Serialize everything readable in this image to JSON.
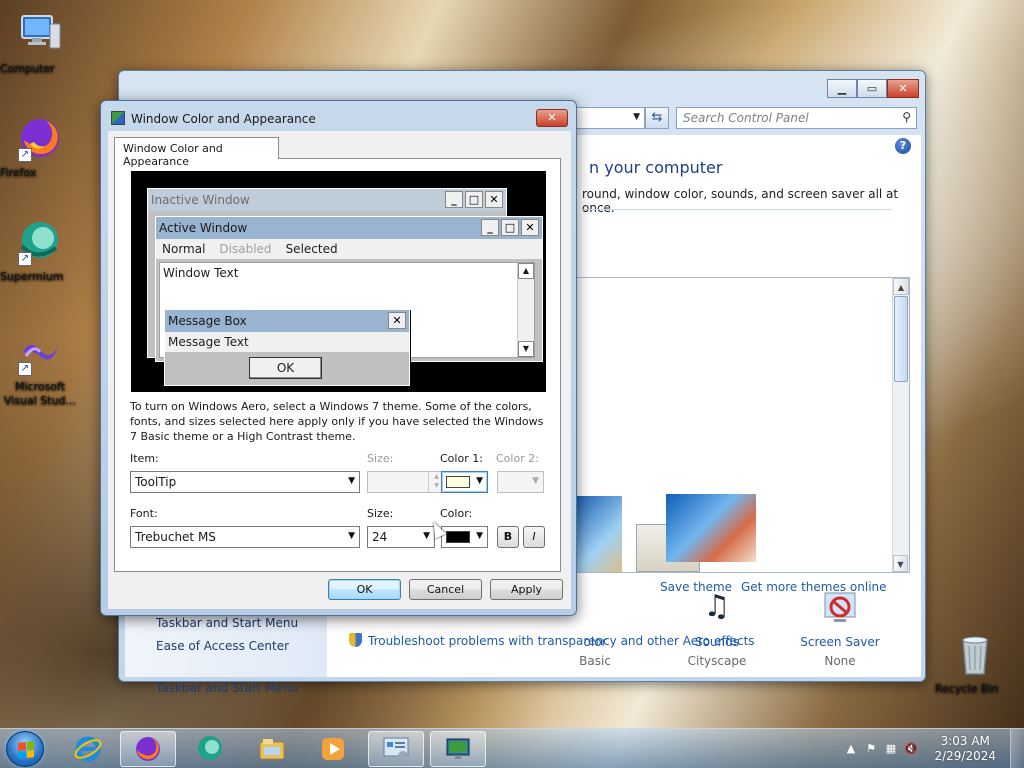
{
  "desktop": {
    "icons": [
      {
        "label": "Computer",
        "icon": "computer-icon"
      },
      {
        "label": "Firefox",
        "icon": "firefox-icon"
      },
      {
        "label": "Supermium",
        "icon": "supermium-icon"
      },
      {
        "label": "Microsoft Visual Stud...",
        "icon": "visual-studio-icon"
      },
      {
        "label": "Recycle Bin",
        "icon": "recycle-bin-icon"
      }
    ]
  },
  "control_panel": {
    "search_placeholder": "Search Control Panel",
    "heading": "n your computer",
    "subheading": "round, window color, sounds, and screen saver all at once.",
    "left_links": [
      "Taskbar and Start Menu",
      "Ease of Access Center"
    ],
    "save_theme": "Save theme",
    "get_more_themes": "Get more themes online",
    "bottom_items": [
      {
        "title": "olor",
        "subtitle": "Basic",
        "icon": "color-icon"
      },
      {
        "title": "Sounds",
        "subtitle": "Cityscape",
        "icon": "sounds-icon"
      },
      {
        "title": "Screen Saver",
        "subtitle": "None",
        "icon": "screen-saver-icon"
      }
    ],
    "troubleshoot": "Troubleshoot problems with transparency and other Aero effects"
  },
  "dialog": {
    "title": "Window Color and Appearance",
    "tab_label": "Window Color and Appearance",
    "preview": {
      "inactive_title": "Inactive Window",
      "active_title": "Active Window",
      "menu_normal": "Normal",
      "menu_disabled": "Disabled",
      "menu_selected": "Selected",
      "window_text": "Window Text",
      "message_box_title": "Message Box",
      "message_text": "Message Text",
      "ok_label": "OK"
    },
    "description": "To turn on Windows Aero, select a Windows 7 theme.  Some of the colors, fonts, and sizes selected here apply only if you have selected the Windows 7 Basic theme or a High Contrast theme.",
    "item_label": "Item:",
    "item_value": "ToolTip",
    "item_size_label": "Size:",
    "color1_label": "Color 1:",
    "color2_label": "Color 2:",
    "color1_value": "#ffffe1",
    "font_label": "Font:",
    "font_value": "Trebuchet MS",
    "font_size_label": "Size:",
    "font_size_value": "24",
    "font_color_label": "Color:",
    "font_color_value": "#000000",
    "bold_label": "B",
    "italic_label": "I",
    "ok": "OK",
    "cancel": "Cancel",
    "apply": "Apply"
  },
  "taskbar": {
    "time": "3:03 AM",
    "date": "2/29/2024",
    "apps": [
      "internet-explorer-icon",
      "firefox-icon",
      "supermium-icon",
      "file-explorer-icon",
      "media-player-icon",
      "control-panel-icon",
      "display-settings-icon"
    ]
  }
}
